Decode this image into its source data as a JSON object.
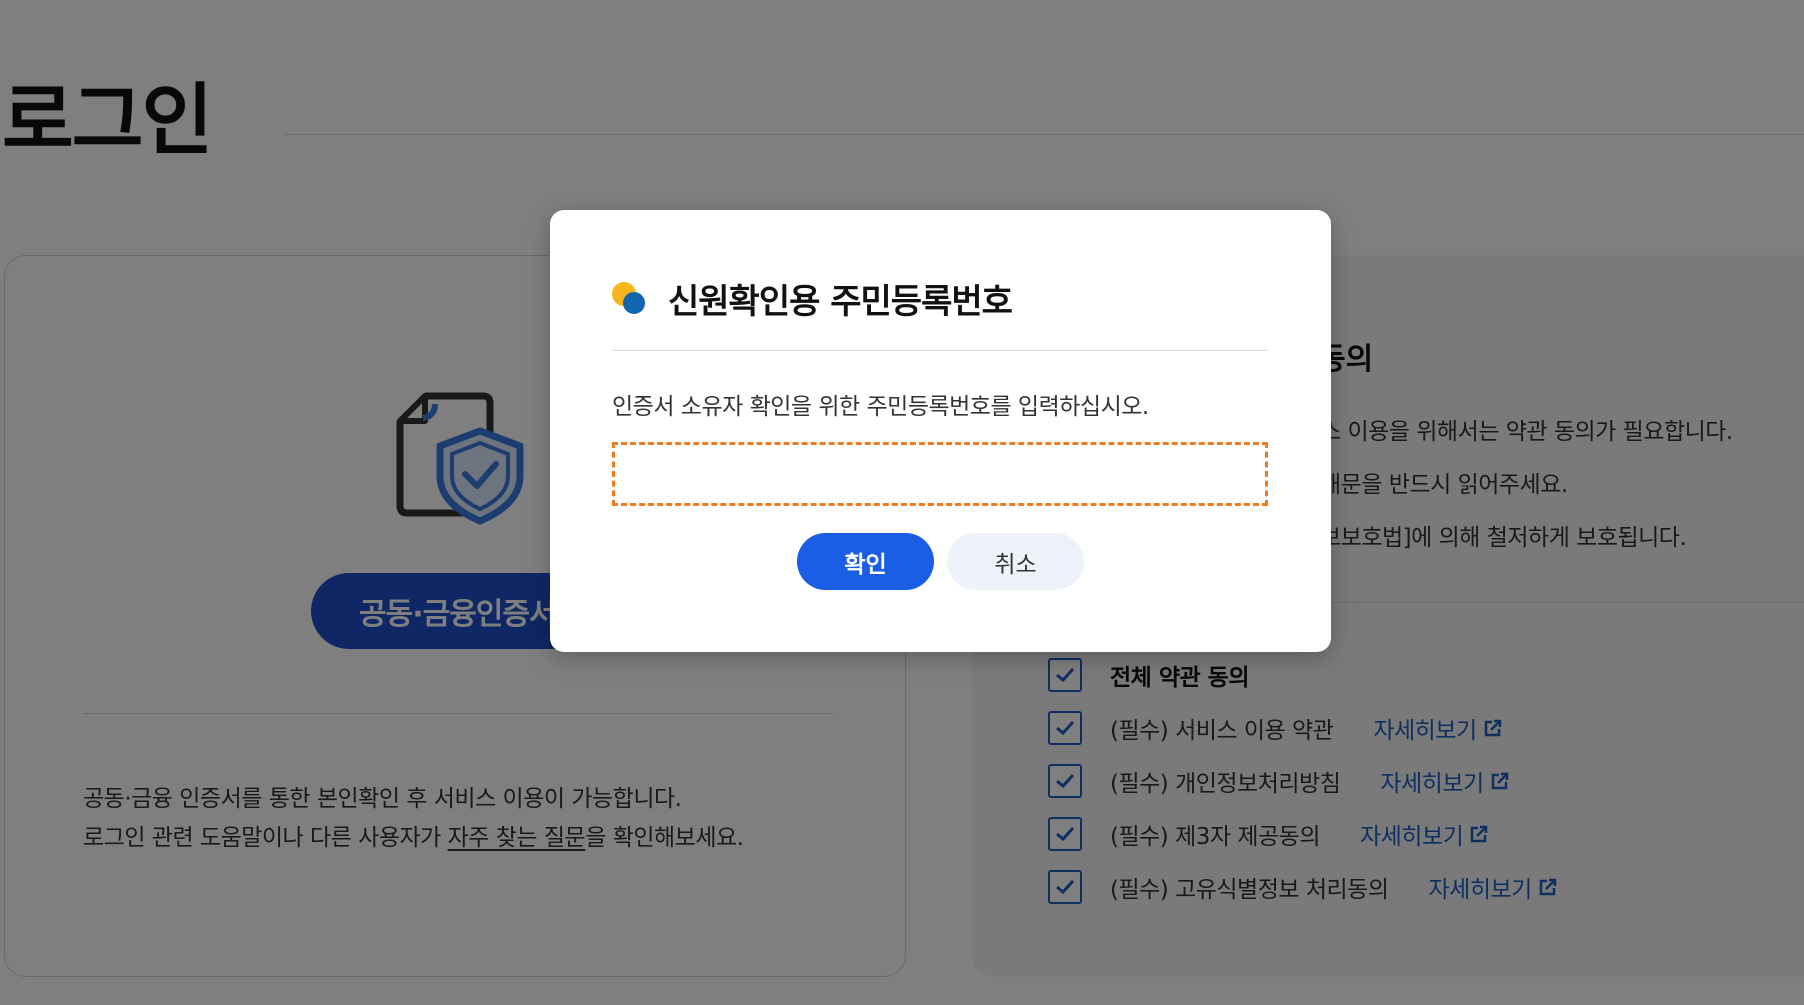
{
  "page": {
    "title": "로그인"
  },
  "left_card": {
    "cert_button_label": "공동·금융인증서",
    "info_line1": "공동·금융 인증서를 통한 본인확인 후 서비스 이용이 가능합니다.",
    "info_line2_prefix": "로그인 관련 도움말이나 다른 사용자가 ",
    "faq_link": "자주 찾는 질문",
    "info_line2_suffix": "을 확인해보세요."
  },
  "right_card": {
    "heading_partial": "동의",
    "line1_partial": "스 이용을 위해서는 약관 동의가 필요합니다.",
    "line2_partial": "해문을 반드시 읽어주세요.",
    "line3_partial": "보보호법]에 의해 철저하게 보호됩니다.",
    "agreements": [
      {
        "label": "전체 약관 동의",
        "checked": true,
        "detail": ""
      },
      {
        "label": "(필수) 서비스 이용 약관",
        "checked": true,
        "detail": "자세히보기"
      },
      {
        "label": "(필수) 개인정보처리방침",
        "checked": true,
        "detail": "자세히보기"
      },
      {
        "label": "(필수) 제3자 제공동의",
        "checked": true,
        "detail": "자세히보기"
      },
      {
        "label": "(필수) 고유식별정보 처리동의",
        "checked": true,
        "detail": "자세히보기"
      }
    ]
  },
  "modal": {
    "title": "신원확인용 주민등록번호",
    "description": "인증서 소유자 확인을 위한 주민등록번호를 입력하십시오.",
    "input_value": "",
    "confirm_label": "확인",
    "cancel_label": "취소"
  },
  "colors": {
    "primary_blue": "#1a5ee6",
    "cert_button_blue": "#1f4ec9",
    "link_blue": "#1f5fc2",
    "input_border_orange": "#f07a20",
    "dot_yellow": "#f6b51d",
    "dot_blue": "#1266b0"
  }
}
